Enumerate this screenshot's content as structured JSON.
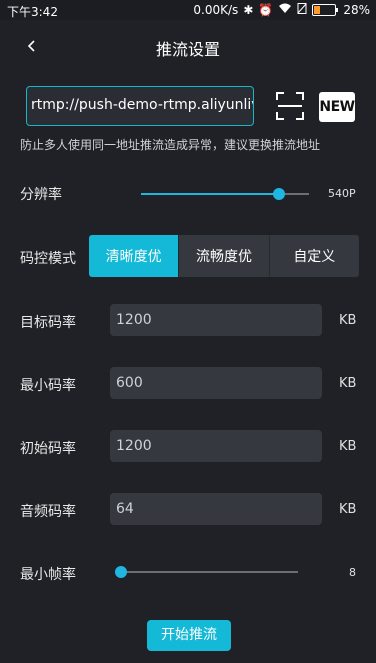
{
  "status_bar": {
    "time": "下午3:42",
    "net_speed": "0.00K/s",
    "battery_percent": "28%",
    "battery_level": 0.28,
    "icons": [
      "bluetooth-icon",
      "alarm-icon",
      "wifi-icon",
      "no-sim-icon",
      "battery-icon"
    ]
  },
  "nav": {
    "title": "推流设置",
    "back_icon": "chevron-left-icon"
  },
  "url": {
    "value": "rtmp://push-demo-rtmp.aliyunlive",
    "scan_icon": "scan-icon",
    "new_label": "NEW"
  },
  "warning": "防止多人使用同一地址推流造成异常，建议更换推流地址",
  "resolution": {
    "label": "分辨率",
    "value": "540P",
    "level": 0.82
  },
  "bitrate_mode": {
    "label": "码控模式",
    "options": [
      "清晰度优",
      "流畅度优",
      "自定义"
    ],
    "selected": "清晰度优"
  },
  "fields": [
    {
      "label": "目标码率",
      "value": "1200",
      "unit": "KB"
    },
    {
      "label": "最小码率",
      "value": "600",
      "unit": "KB"
    },
    {
      "label": "初始码率",
      "value": "1200",
      "unit": "KB"
    },
    {
      "label": "音频码率",
      "value": "64",
      "unit": "KB"
    }
  ],
  "min_fps": {
    "label": "最小帧率",
    "value": "8",
    "level": 0.0
  },
  "start_button": "开始推流",
  "colors": {
    "accent": "#13b9d6",
    "background": "#1f2127",
    "input_bg": "#35383f"
  }
}
